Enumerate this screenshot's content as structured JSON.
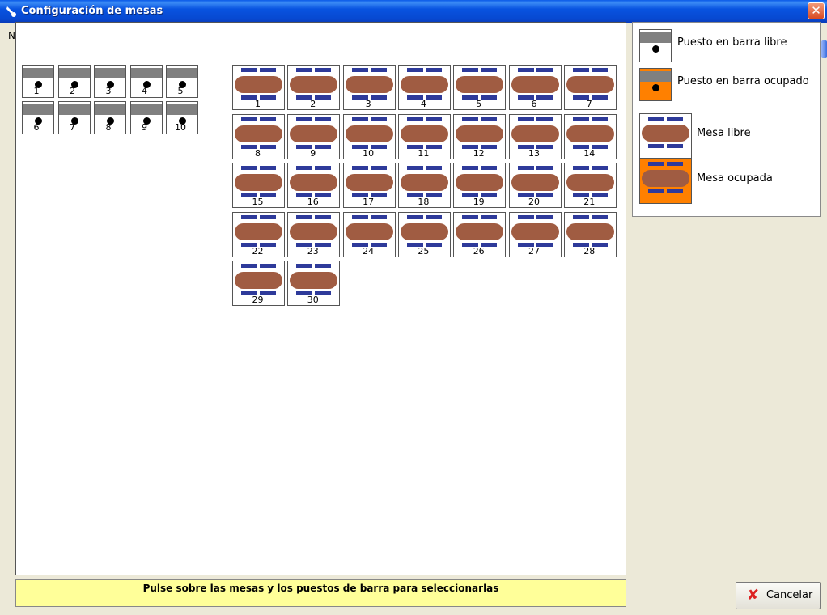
{
  "window": {
    "title": "Configuración de mesas",
    "close_glyph": "✕",
    "menu_stub": "N"
  },
  "bar_seats": [
    "1",
    "2",
    "3",
    "4",
    "5",
    "6",
    "7",
    "8",
    "9",
    "10"
  ],
  "tables": [
    "1",
    "2",
    "3",
    "4",
    "5",
    "6",
    "7",
    "8",
    "9",
    "10",
    "11",
    "12",
    "13",
    "14",
    "15",
    "16",
    "17",
    "18",
    "19",
    "20",
    "21",
    "22",
    "23",
    "24",
    "25",
    "26",
    "27",
    "28",
    "29",
    "30"
  ],
  "legend": {
    "bar_free": "Puesto en barra libre",
    "bar_occupied": "Puesto en barra ocupado",
    "table_free": "Mesa libre",
    "table_occupied": "Mesa ocupada"
  },
  "status_message": "Pulse sobre las mesas y  los puestos de barra para seleccionarlas",
  "cancel_label": "Cancelar",
  "colors": {
    "table": "#a05c42",
    "chair": "#2e3a9a",
    "occupied": "#ff8000",
    "status_bg": "#ffff99"
  }
}
